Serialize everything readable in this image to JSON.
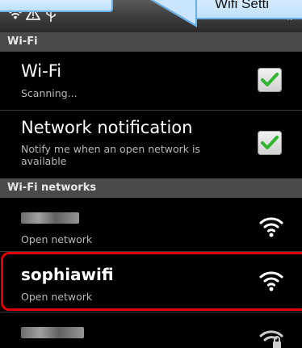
{
  "callout": {
    "text": "Wifi Setti"
  },
  "status_icons": [
    "wifi-signal-icon",
    "warning-icon",
    "usb-icon"
  ],
  "sections": {
    "wifi_header": "Wi-Fi",
    "networks_header": "Wi-Fi networks"
  },
  "settings": {
    "wifi": {
      "title": "Wi-Fi",
      "subtitle": "Scanning...",
      "checked": true
    },
    "notification": {
      "title": "Network notification",
      "subtitle": "Notify me when an open network is available",
      "checked": true
    }
  },
  "networks": [
    {
      "name": "",
      "status": "Open network",
      "icon": "wifi-signal-icon"
    },
    {
      "name": "sophiawifi",
      "status": "Open network",
      "icon": "wifi-signal-icon",
      "highlighted": true
    },
    {
      "name": "",
      "status": "",
      "icon": "wifi-locked-icon"
    }
  ],
  "colors": {
    "checkmark": "#2fb52f",
    "highlight": "#e00000",
    "section_bg": "#4a4a4a"
  }
}
